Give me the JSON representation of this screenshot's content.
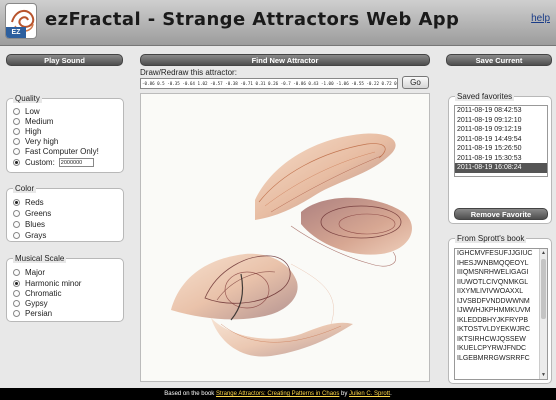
{
  "header": {
    "logo_text": "EZ",
    "title": "ezFractal - Strange Attractors Web App",
    "help_label": "help"
  },
  "toolbar": {
    "play_sound": "Play Sound",
    "find_new": "Find New Attractor",
    "save_current": "Save Current",
    "draw_label": "Draw/Redraw this attractor:",
    "formula": "-0.86 0.5 -0.35 -0.64 1.02 -0.57 -0.38 -0.71 0.31 0.26 -0.7 -0.86 0.43 -1.00 -1.06 -0.55 -0.22 0.72 0.79 0.47 -1.11 -0.02 -0.01 -1.04 1.0",
    "go_label": "Go"
  },
  "quality": {
    "title": "Quality",
    "options": [
      "Low",
      "Medium",
      "High",
      "Very high",
      "Fast Computer Only!",
      "Custom:"
    ],
    "selected": 5,
    "custom_value": "2000000"
  },
  "color": {
    "title": "Color",
    "options": [
      "Reds",
      "Greens",
      "Blues",
      "Grays"
    ],
    "selected": 0
  },
  "musical": {
    "title": "Musical Scale",
    "options": [
      "Major",
      "Harmonic minor",
      "Chromatic",
      "Gypsy",
      "Persian"
    ],
    "selected": 1
  },
  "saved": {
    "title": "Saved favorites",
    "items": [
      "2011-08-19 08:42:53",
      "2011-08-19 09:12:10",
      "2011-08-19 09:12:19",
      "2011-08-19 14:49:54",
      "2011-08-19 15:26:50",
      "2011-08-19 15:30:53",
      "2011-08-19 16:08:24"
    ],
    "selected": 6,
    "remove_label": "Remove Favorite"
  },
  "sprott": {
    "title": "From Sprott's book",
    "items": [
      "IGHCMVFESUFJJGIUC",
      "IHESJWNBMQQEOYL",
      "IIIQMSNRHWELIGAGI",
      "IIUWOTLCIVQNMKGL",
      "IIXYMLIVIVWOAXXL",
      "IJVSBDFVNDDWWNM",
      "IJWWHJKPHMMKUVM",
      "IKLEDDBHYJKFRYPB",
      "IKTOSTVLDYEKWJRC",
      "IKTSIRHCWJQSSEW",
      "IKUELCPYRWJFNDC",
      "ILGEBMRRGWSRRFC"
    ]
  },
  "footer": {
    "prefix": "Based on the book ",
    "book": "Strange Attractors: Creating Patterns in Chaos",
    "by": " by ",
    "author": "Julien C. Sprott",
    "suffix": "."
  },
  "colors": {
    "attractor_light": "#e8a071",
    "attractor_mid": "#c87048",
    "attractor_dark": "#5a1e22"
  }
}
